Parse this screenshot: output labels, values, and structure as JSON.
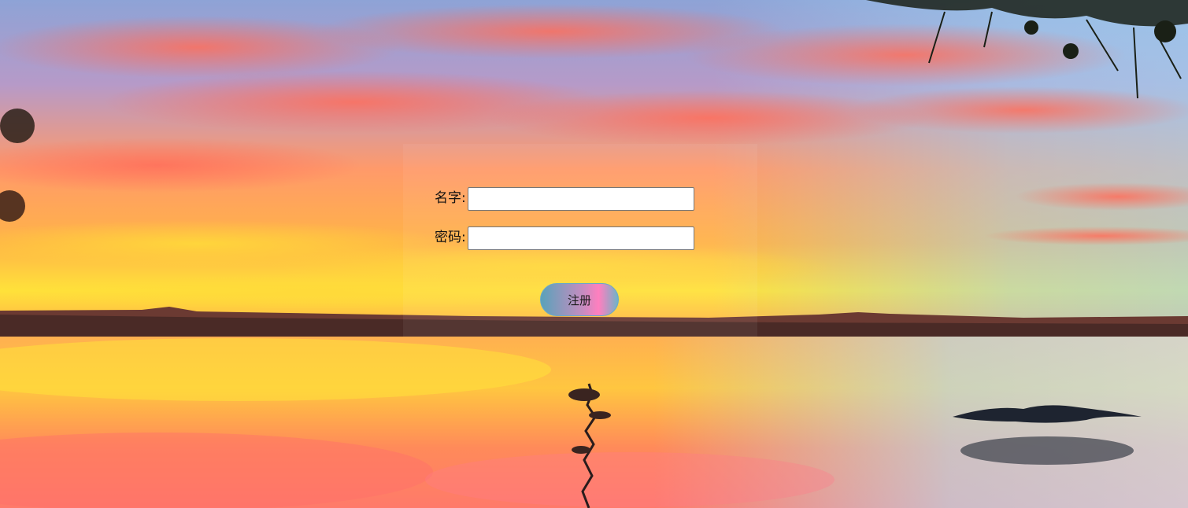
{
  "form": {
    "name_label": "名字:",
    "name_value": "",
    "password_label": "密码:",
    "password_value": "",
    "register_label": "注册"
  },
  "colors": {
    "button_gradient_start": "#5aa2ba",
    "button_gradient_mid": "#ff7fbf",
    "sky_top": "#8aa6d8",
    "horizon": "#ffd23a",
    "water": "#ffb24a"
  }
}
